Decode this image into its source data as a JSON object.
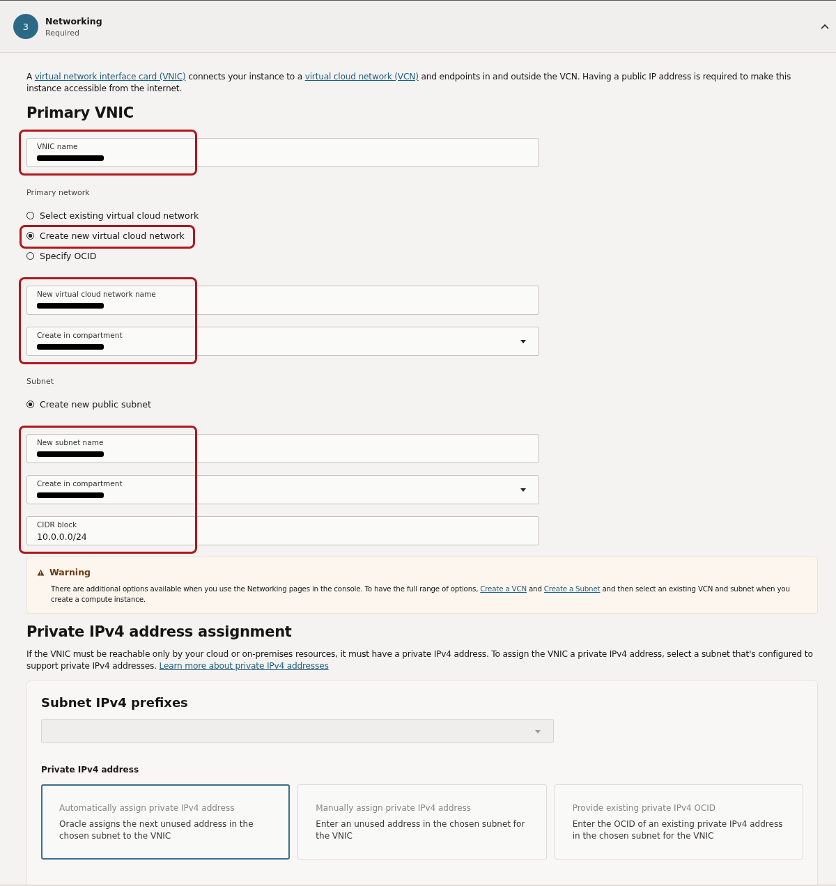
{
  "step": {
    "number": "3",
    "title": "Networking",
    "subtitle": "Required",
    "expanded": true
  },
  "intro": [
    {
      "text": "A "
    },
    {
      "text": "virtual network interface card (VNIC)",
      "link": true
    },
    {
      "text": " connects your instance to a "
    },
    {
      "text": "virtual cloud network (VCN)",
      "link": true
    },
    {
      "text": " and endpoints in and outside the VCN. Having a public IP address is required to make this instance accessible from the internet."
    }
  ],
  "primary_vnic": {
    "heading": "Primary VNIC",
    "blocks": [
      {
        "kind": "fields",
        "highlighted": true,
        "fields": [
          {
            "kind": "text",
            "label": "VNIC name",
            "redacted": true
          }
        ]
      },
      {
        "kind": "radios",
        "label": "Primary network",
        "options": [
          {
            "label": "Select existing virtual cloud network",
            "selected": false,
            "highlighted": false
          },
          {
            "label": "Create new virtual cloud network",
            "selected": true,
            "highlighted": true
          },
          {
            "label": "Specify OCID",
            "selected": false,
            "highlighted": false
          }
        ]
      },
      {
        "kind": "fields",
        "highlighted": true,
        "fields": [
          {
            "kind": "text",
            "label": "New virtual cloud network name",
            "redacted": true
          },
          {
            "kind": "select",
            "label": "Create in compartment",
            "redacted": true
          }
        ]
      },
      {
        "kind": "radios",
        "label": "Subnet",
        "options": [
          {
            "label": "Create new public subnet",
            "selected": true,
            "highlighted": false
          }
        ]
      },
      {
        "kind": "fields",
        "highlighted": true,
        "fields": [
          {
            "kind": "text",
            "label": "New subnet name",
            "redacted": true
          },
          {
            "kind": "select",
            "label": "Create in compartment",
            "redacted": true
          },
          {
            "kind": "text",
            "label": "CIDR block",
            "value": "10.0.0.0/24",
            "redacted": false
          }
        ]
      }
    ]
  },
  "warning": {
    "title": "Warning",
    "message": [
      {
        "text": "There are additional options available when you use the Networking pages in the console. To have the full range of options, "
      },
      {
        "text": "Create a VCN",
        "link": true
      },
      {
        "text": " and "
      },
      {
        "text": "Create a Subnet",
        "link": true
      },
      {
        "text": " and then select an existing VCN and subnet when you create a compute instance."
      }
    ]
  },
  "private_ipv4": {
    "heading": "Private IPv4 address assignment",
    "description": [
      {
        "text": "If the VNIC must be reachable only by your cloud or on-premises resources, it must have a private IPv4 address. To assign the VNIC a private IPv4 address, select a subnet that's configured to support private IPv4 addresses. "
      },
      {
        "text": "Learn more about private IPv4 addresses",
        "link": true
      }
    ],
    "panel": {
      "heading": "Subnet IPv4 prefixes",
      "prefix_select": {
        "disabled": true
      },
      "label": "Private IPv4 address",
      "cards": [
        {
          "title": "Automatically assign private IPv4 address",
          "description": "Oracle assigns the next unused address in the chosen subnet to the VNIC",
          "selected": true
        },
        {
          "title": "Manually assign private IPv4 address",
          "description": "Enter an unused address in the chosen subnet for the VNIC",
          "selected": false
        },
        {
          "title": "Provide existing private IPv4 OCID",
          "description": "Enter the OCID of an existing private IPv4 address in the chosen subnet for the VNIC",
          "selected": false
        }
      ]
    }
  }
}
